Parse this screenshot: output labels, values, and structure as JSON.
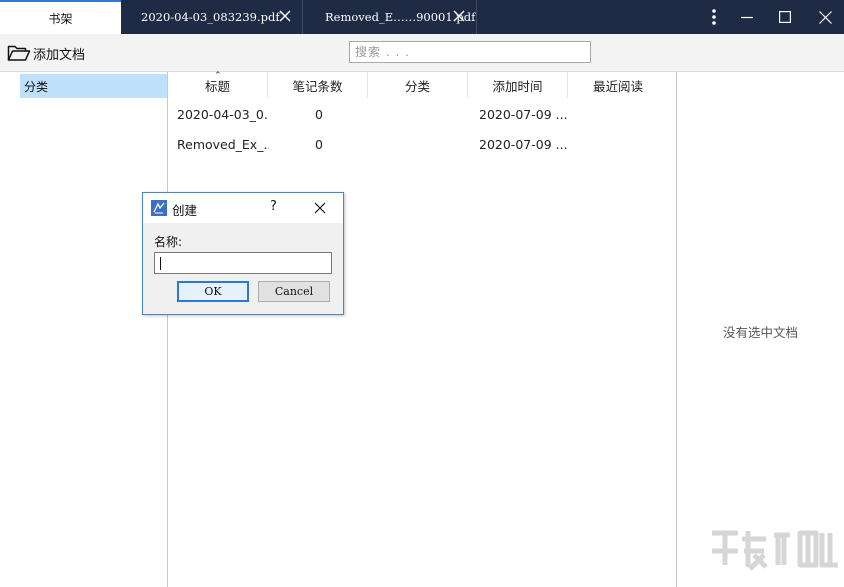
{
  "tabs": [
    {
      "label": "书架",
      "active": true
    },
    {
      "label": "2020-04-03_083239.pdf",
      "active": false
    },
    {
      "label": "Removed_E……90001.pdf",
      "active": false
    }
  ],
  "toolbar": {
    "add_doc_label": "添加文档",
    "search_placeholder": "搜索 . . ."
  },
  "categories": [
    {
      "label": "分类"
    }
  ],
  "table": {
    "columns": [
      "标题",
      "笔记条数",
      "分类",
      "添加时间",
      "最近阅读"
    ],
    "rows": [
      {
        "title": "2020-04-03_0...",
        "notes": "0",
        "category": "",
        "added": "2020-07-09 ...",
        "recent": ""
      },
      {
        "title": "Removed_Ex_...",
        "notes": "0",
        "category": "",
        "added": "2020-07-09 ...",
        "recent": ""
      }
    ]
  },
  "detail": {
    "empty_text": "没有选中文档"
  },
  "dialog": {
    "title": "创建",
    "help": "?",
    "name_label": "名称:",
    "name_value": "",
    "ok_label": "OK",
    "cancel_label": "Cancel"
  },
  "colors": {
    "tabbar": "#1f2a44",
    "accent": "#2f7ad8",
    "selection": "#bfe0fb"
  },
  "icons": [
    "more-vertical-icon",
    "minimize-icon",
    "maximize-icon",
    "close-icon",
    "folder-open-icon",
    "app-icon"
  ]
}
